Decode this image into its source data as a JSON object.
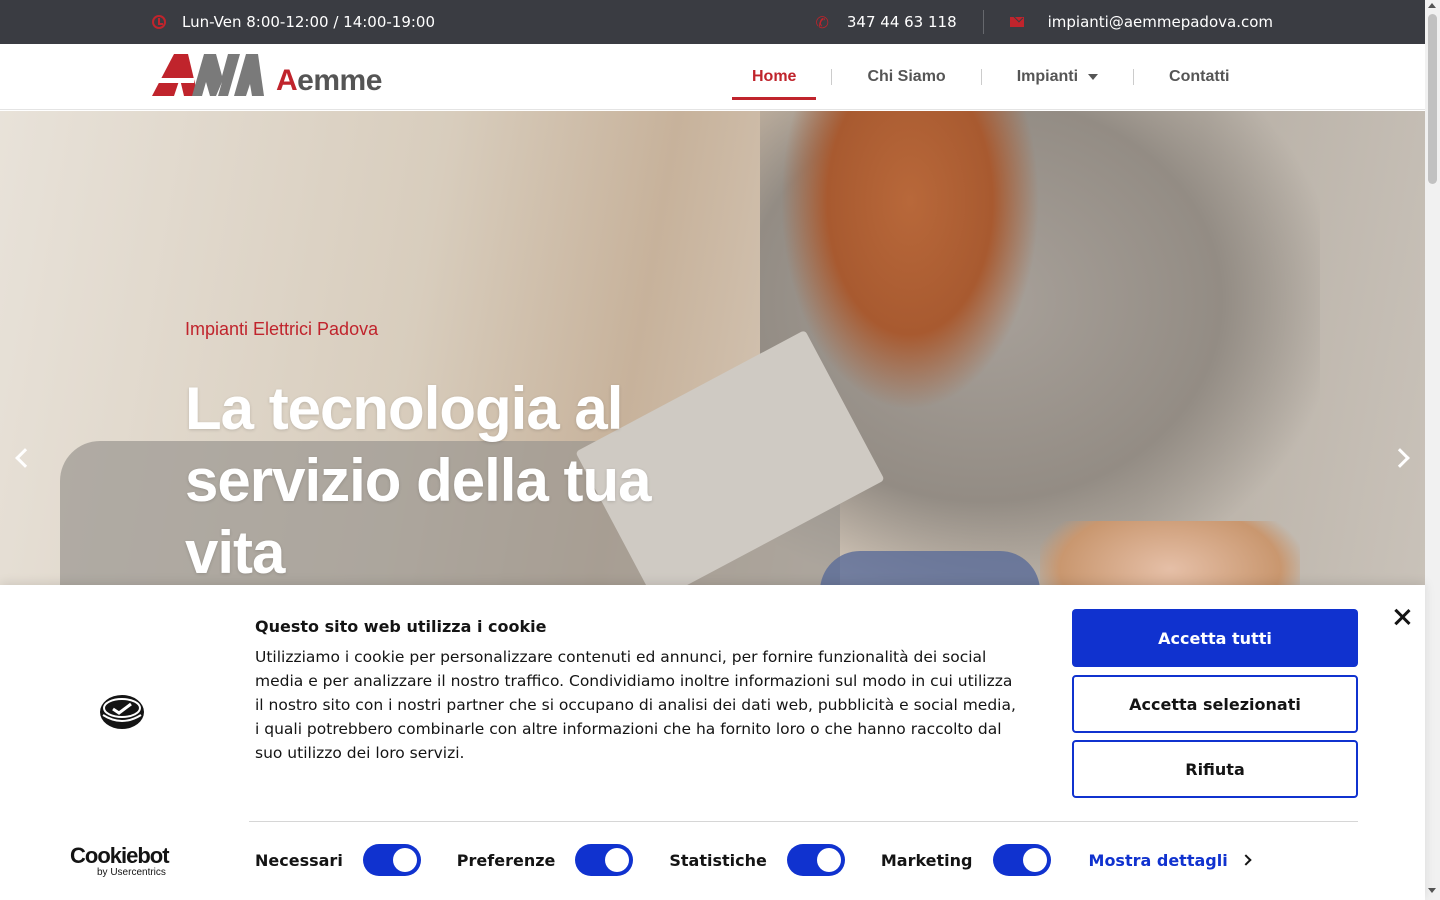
{
  "topbar": {
    "hours": "Lun-Ven 8:00-12:00 / 14:00-19:00",
    "phone": "347 44 63 118",
    "email": "impianti@aemmepadova.com"
  },
  "header": {
    "logo_a": "A",
    "logo_rest": "emme",
    "nav": [
      {
        "label": "Home",
        "active": true
      },
      {
        "label": "Chi Siamo"
      },
      {
        "label": "Impianti",
        "dropdown": true
      },
      {
        "label": "Contatti"
      }
    ]
  },
  "hero": {
    "subtitle": "Impianti Elettrici Padova",
    "title": "La tecnologia al servizio della tua vita"
  },
  "cookie": {
    "heading": "Questo sito web utilizza i cookie",
    "body": "Utilizziamo i cookie per personalizzare contenuti ed annunci, per fornire funzionalità dei social media e per analizzare il nostro traffico. Condividiamo inoltre informazioni sul modo in cui utilizza il nostro sito con i nostri partner che si occupano di analisi dei dati web, pubblicità e social media, i quali potrebbero combinarle con altre informazioni che ha fornito loro o che hanno raccolto dal suo utilizzo dei loro servizi.",
    "accept_all": "Accetta tutti",
    "accept_selected": "Accetta selezionati",
    "reject": "Rifiuta",
    "toggles": [
      {
        "label": "Necessari",
        "on": true
      },
      {
        "label": "Preferenze",
        "on": true
      },
      {
        "label": "Statistiche",
        "on": true
      },
      {
        "label": "Marketing",
        "on": true
      }
    ],
    "details": "Mostra dettagli",
    "brand": "Cookiebot",
    "brand_sub": "by Usercentrics"
  },
  "colors": {
    "accent": "#c0242c",
    "cookie_blue": "#1032cf",
    "topbar_bg": "#3a3c42"
  }
}
